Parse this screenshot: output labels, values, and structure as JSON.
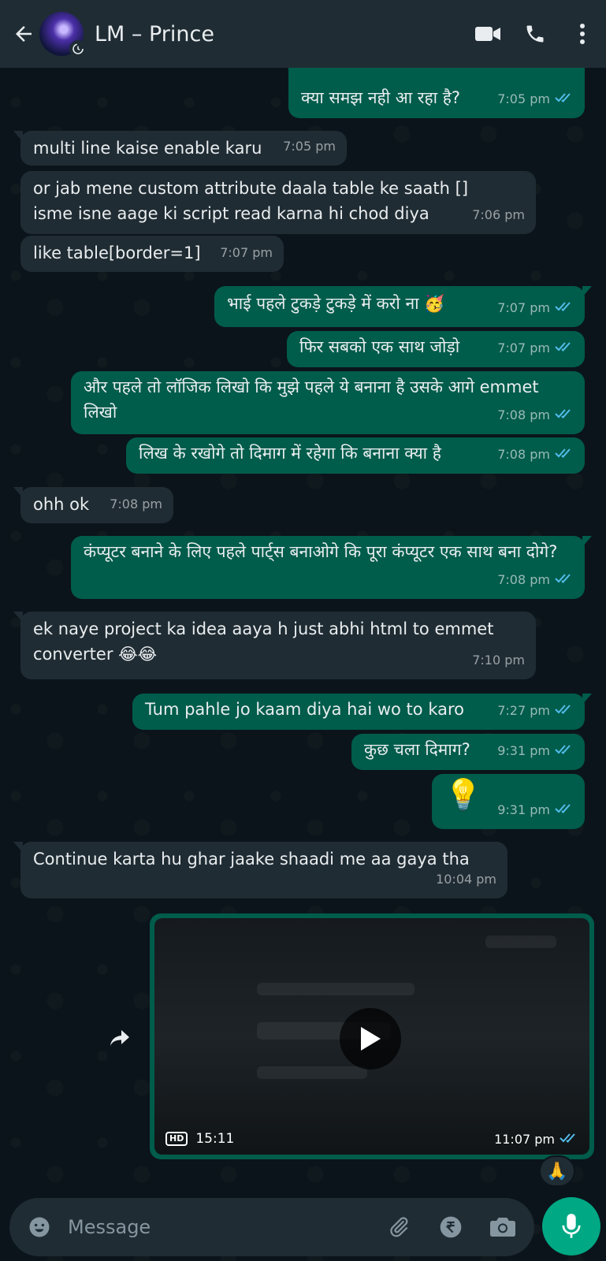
{
  "header": {
    "contact_name": "LM – Prince"
  },
  "messages": [
    {
      "dir": "out",
      "text": "क्या समझ नही आ रहा है?",
      "time": "7:05 pm"
    },
    {
      "dir": "in",
      "text": "multi line kaise enable karu",
      "time": "7:05 pm"
    },
    {
      "dir": "in",
      "text": "or jab mene custom attribute daala table ke saath [] isme isne aage ki script read karna hi chod diya",
      "time": "7:06 pm"
    },
    {
      "dir": "in",
      "text": "like table[border=1]",
      "time": "7:07 pm"
    },
    {
      "dir": "out",
      "text": "भाई पहले टुकड़े टुकड़े में करो ना 🥳",
      "time": "7:07 pm"
    },
    {
      "dir": "out",
      "text": "फिर सबको एक साथ जोड़ो",
      "time": "7:07 pm"
    },
    {
      "dir": "out",
      "text": "और पहले तो लॉजिक लिखो कि मुझे पहले ये बनाना है उसके आगे emmet लिखो",
      "time": "7:08 pm"
    },
    {
      "dir": "out",
      "text": "लिख के रखोगे तो दिमाग में रहेगा कि बनाना क्या है",
      "time": "7:08 pm"
    },
    {
      "dir": "in",
      "text": "ohh ok",
      "time": "7:08 pm"
    },
    {
      "dir": "out",
      "text": "कंप्यूटर बनाने के लिए पहले पार्ट्स बनाओगे कि पूरा कंप्यूटर एक साथ बना दोगे?",
      "time": "7:08 pm"
    },
    {
      "dir": "in",
      "text": "ek naye project ka idea aaya h just abhi html to emmet converter 😂😂",
      "time": "7:10 pm"
    },
    {
      "dir": "out",
      "text": "Tum pahle jo kaam diya hai wo to karo",
      "time": "7:27 pm"
    },
    {
      "dir": "out",
      "text": "कुछ चला दिमाग?",
      "time": "9:31 pm"
    },
    {
      "dir": "out",
      "text": "💡",
      "time": "9:31 pm"
    },
    {
      "dir": "in",
      "text": "Continue karta hu ghar jaake shaadi me aa gaya tha",
      "time": "10:04 pm"
    }
  ],
  "video": {
    "quality": "HD",
    "duration": "15:11",
    "time": "11:07 pm",
    "reaction": "🙏"
  },
  "input": {
    "placeholder": "Message"
  },
  "colors": {
    "background": "#0b141a",
    "header": "#1f2c34",
    "incoming": "#202c33",
    "outgoing": "#005c4b",
    "accent": "#00a884",
    "read_tick": "#53bdeb"
  }
}
